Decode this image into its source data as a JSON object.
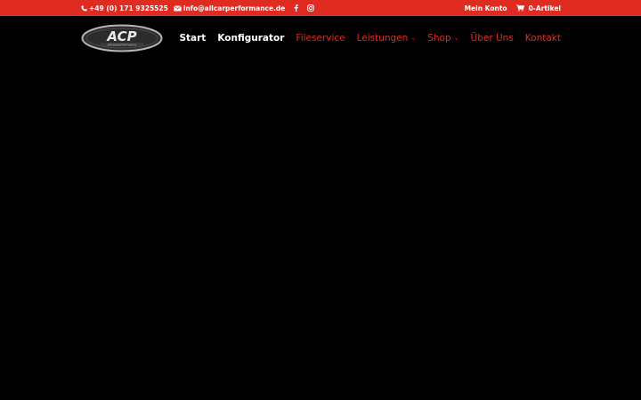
{
  "topbar": {
    "phone": "+49 (0) 171 9325525",
    "email": "info@allcarperformance.de",
    "account_label": "Mein Konto",
    "cart_label": "0-Artikel"
  },
  "header": {
    "logo_text": "ACP",
    "logo_subtext": "allcarperformance"
  },
  "nav": {
    "items": [
      {
        "label": "Start"
      },
      {
        "label": "Konfigurator"
      },
      {
        "label": "Fileservice"
      },
      {
        "label": "Leistungen"
      },
      {
        "label": "Shop"
      },
      {
        "label": "Über Uns"
      },
      {
        "label": "Kontakt"
      }
    ]
  },
  "colors": {
    "brand_red": "#e02b20",
    "background": "#000000",
    "nav_active": "#ffffff"
  },
  "icons": [
    "phone-icon",
    "envelope-icon",
    "facebook-icon",
    "instagram-icon",
    "cart-icon",
    "chevron-down-icon"
  ]
}
